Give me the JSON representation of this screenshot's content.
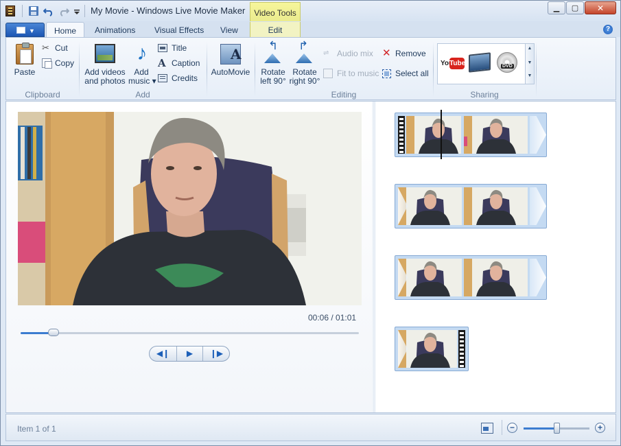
{
  "window": {
    "title": "My Movie - Windows Live Movie Maker",
    "context_tab_header": "Video Tools",
    "buttons": {
      "minimize": "▁",
      "maximize": "▢",
      "close": "✕"
    }
  },
  "tabs": [
    {
      "label": "Home",
      "active": true
    },
    {
      "label": "Animations"
    },
    {
      "label": "Visual Effects"
    },
    {
      "label": "View"
    },
    {
      "label": "Edit",
      "contextual": true
    }
  ],
  "ribbon": {
    "clipboard": {
      "label": "Clipboard",
      "paste": "Paste",
      "cut": "Cut",
      "copy": "Copy"
    },
    "add": {
      "label": "Add",
      "add_videos_1": "Add videos",
      "add_videos_2": "and photos",
      "add_music_1": "Add",
      "add_music_2": "music ▾",
      "title": "Title",
      "caption": "Caption",
      "credits": "Credits"
    },
    "automovie": {
      "label": "AutoMovie"
    },
    "editing": {
      "label": "Editing",
      "rotate_left_1": "Rotate",
      "rotate_left_2": "left 90°",
      "rotate_right_1": "Rotate",
      "rotate_right_2": "right 90°",
      "audio_mix": "Audio mix",
      "fit_to_music": "Fit to music",
      "remove": "Remove",
      "select_all": "Select all"
    },
    "sharing": {
      "label": "Sharing",
      "youtube_1": "You",
      "youtube_2": "Tube",
      "dvd": "DVD"
    }
  },
  "preview": {
    "time_readout": "00:06 / 01:01",
    "progress_fraction": 0.098
  },
  "transport": {
    "prev": "◀❙",
    "play": "▶",
    "next": "❙▶"
  },
  "status": {
    "text": "Item 1 of 1",
    "zoom_fraction": 0.5,
    "zoom_out": "−",
    "zoom_in": "+"
  },
  "colors": {
    "accent": "#3b7cd0",
    "context_tab": "#eaeb8e",
    "remove_icon": "#d2262a"
  }
}
